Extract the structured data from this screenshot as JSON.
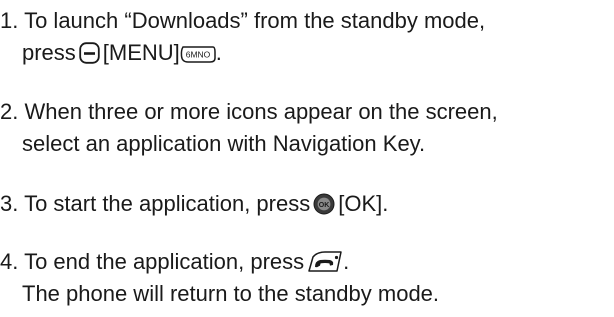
{
  "steps": [
    {
      "number": "1.",
      "line1": "To launch “Downloads” from the standby mode,",
      "line2_prefix": "press",
      "line2_key_label": "[MENU]",
      "line2_suffix": ".",
      "icons": [
        "left-soft-key-icon",
        "menu-6-key-icon"
      ],
      "menu_key_glyph": "6MNO"
    },
    {
      "number": "2.",
      "line1": "When three or more icons appear on the screen,",
      "line2": "select an application with Navigation Key."
    },
    {
      "number": "3.",
      "prefix": "To start the application, press",
      "key_label": "[OK].",
      "icons": [
        "ok-key-icon"
      ],
      "ok_glyph": "OK"
    },
    {
      "number": "4.",
      "prefix": "To end the application, press",
      "suffix": ".",
      "line2": "The phone will return to the standby mode.",
      "icons": [
        "end-key-icon"
      ]
    }
  ]
}
